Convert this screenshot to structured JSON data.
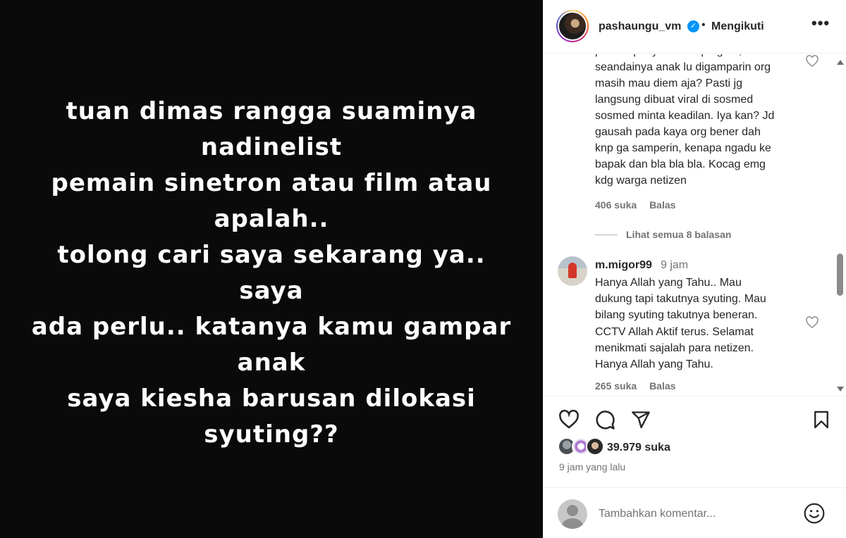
{
  "post": {
    "text": "tuan dimas rangga suaminya nadinelist\npemain sinetron atau film atau apalah..\ntolong cari saya sekarang ya.. saya\nada perlu.. katanya kamu gampar anak\nsaya kiesha barusan dilokasi syuting??"
  },
  "header": {
    "username": "pashaungu_vm",
    "separator": "•",
    "follow_label": "Mengikuti",
    "more_label": "•••"
  },
  "comments": {
    "reply": {
      "text": "pernah punya anak apa gmn,\nseandainya anak lu digamparin org\nmasih mau diem aja? Pasti jg\nlangsung dibuat viral di sosmed\nsosmed minta keadilan. Iya kan? Jd\ngausah pada kaya org bener dah\nknp ga samperin, kenapa ngadu ke\nbapak dan bla bla bla. Kocag emg\nkdg warga netizen",
      "likes": "406 suka",
      "reply_label": "Balas"
    },
    "view_replies": "Lihat semua 8 balasan",
    "comment": {
      "username": "m.migor99",
      "time": "9 jam",
      "text": "Hanya Allah yang Tahu.. Mau\ndukung tapi takutnya syuting. Mau\nbilang syuting takutnya beneran.\nCCTV Allah Aktif terus. Selamat\nmenikmati sajalah para netizen.\nHanya Allah yang Tahu.",
      "likes": "265 suka",
      "reply_label": "Balas"
    }
  },
  "actions": {
    "icons": [
      "heart-icon",
      "comment-icon",
      "share-icon",
      "bookmark-icon"
    ],
    "likes_count": "39.979 suka",
    "time_ago": "9 jam yang lalu"
  },
  "add_comment": {
    "placeholder": "Tambahkan komentar..."
  },
  "colors": {
    "image_bg": "#0a0a0a",
    "verified": "#0095f6",
    "muted_text": "#737373"
  }
}
